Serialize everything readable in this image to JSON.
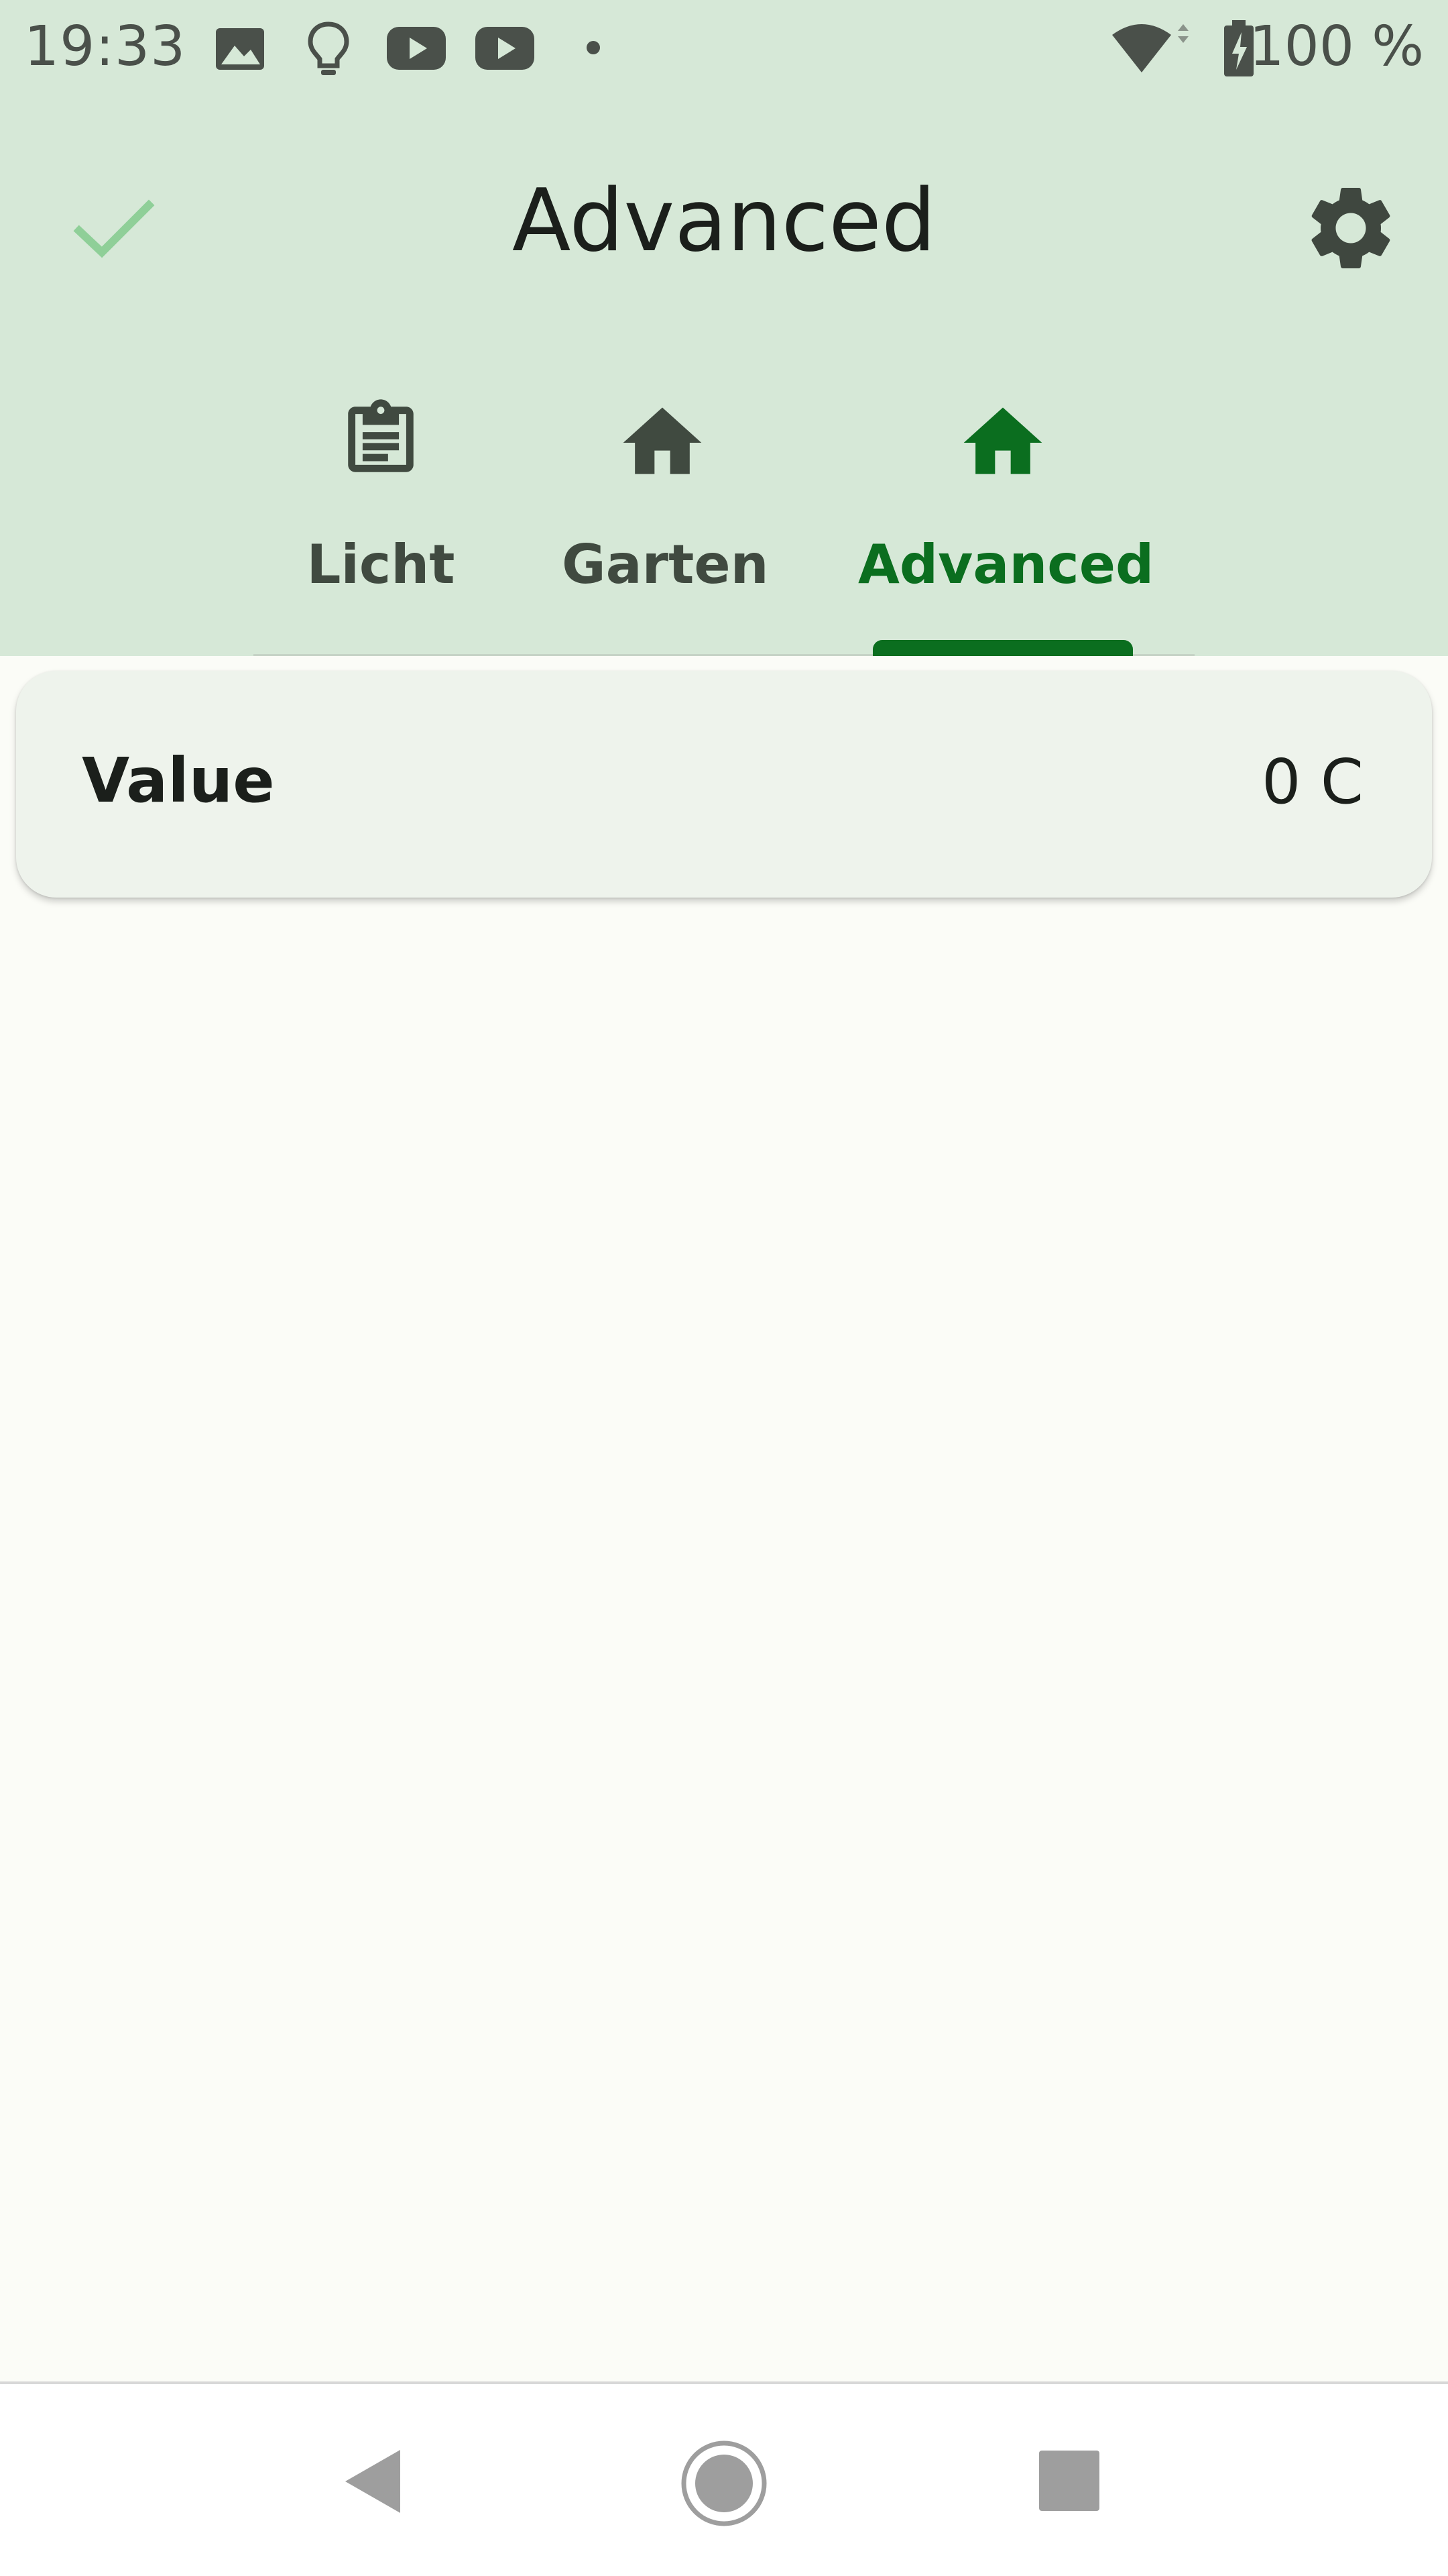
{
  "status_bar": {
    "time": "19:33",
    "battery_text": "100 %",
    "notification_icons": [
      "image-icon",
      "lightbulb-icon",
      "youtube-icon",
      "youtube-icon",
      "dot-icon"
    ],
    "right_icons": [
      "wifi-icon",
      "battery-charging-icon"
    ]
  },
  "toolbar": {
    "title": "Advanced",
    "left_icon": "check-icon",
    "right_icon": "gear-icon"
  },
  "tabs": [
    {
      "label": "Licht",
      "icon": "clipboard-icon",
      "active": false
    },
    {
      "label": "Garten",
      "icon": "home-icon",
      "active": false
    },
    {
      "label": "Advanced",
      "icon": "home-icon",
      "active": true
    }
  ],
  "card": {
    "label": "Value",
    "value": "0 C"
  },
  "nav_bar": {
    "buttons": [
      "back-icon",
      "home-circle-icon",
      "recents-icon"
    ]
  },
  "colors": {
    "app_bar_bg": "#d6e8d7",
    "accent": "#0b6e1f",
    "check_icon": "#8fcf98",
    "body_bg": "#fbfcf7",
    "card_bg": "#eef3ec"
  }
}
